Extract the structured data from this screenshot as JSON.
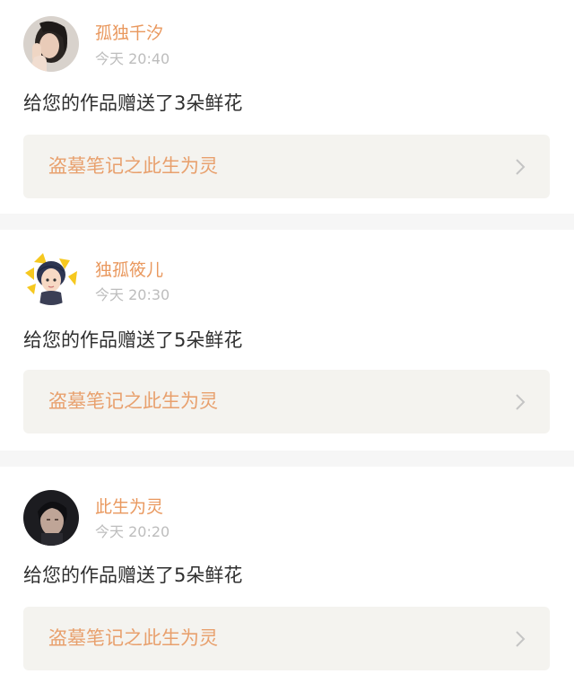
{
  "notifications": [
    {
      "username": "孤独千汐",
      "time": "今天 20:40",
      "message": "给您的作品赠送了3朵鲜花",
      "work_title": "盗墓笔记之此生为灵",
      "avatar_icon": "user-photo-avatar"
    },
    {
      "username": "独孤筱儿",
      "time": "今天 20:30",
      "message": "给您的作品赠送了5朵鲜花",
      "work_title": "盗墓笔记之此生为灵",
      "avatar_icon": "cartoon-girl-avatar"
    },
    {
      "username": "此生为灵",
      "time": "今天 20:20",
      "message": "给您的作品赠送了5朵鲜花",
      "work_title": "盗墓笔记之此生为灵",
      "avatar_icon": "user-photo-avatar"
    }
  ],
  "colors": {
    "username": "#e9985e",
    "work_title": "#e8a06d",
    "time": "#bdbdbd",
    "card_link_bg": "#f4f3ef",
    "separator": "#f6f6f6"
  }
}
